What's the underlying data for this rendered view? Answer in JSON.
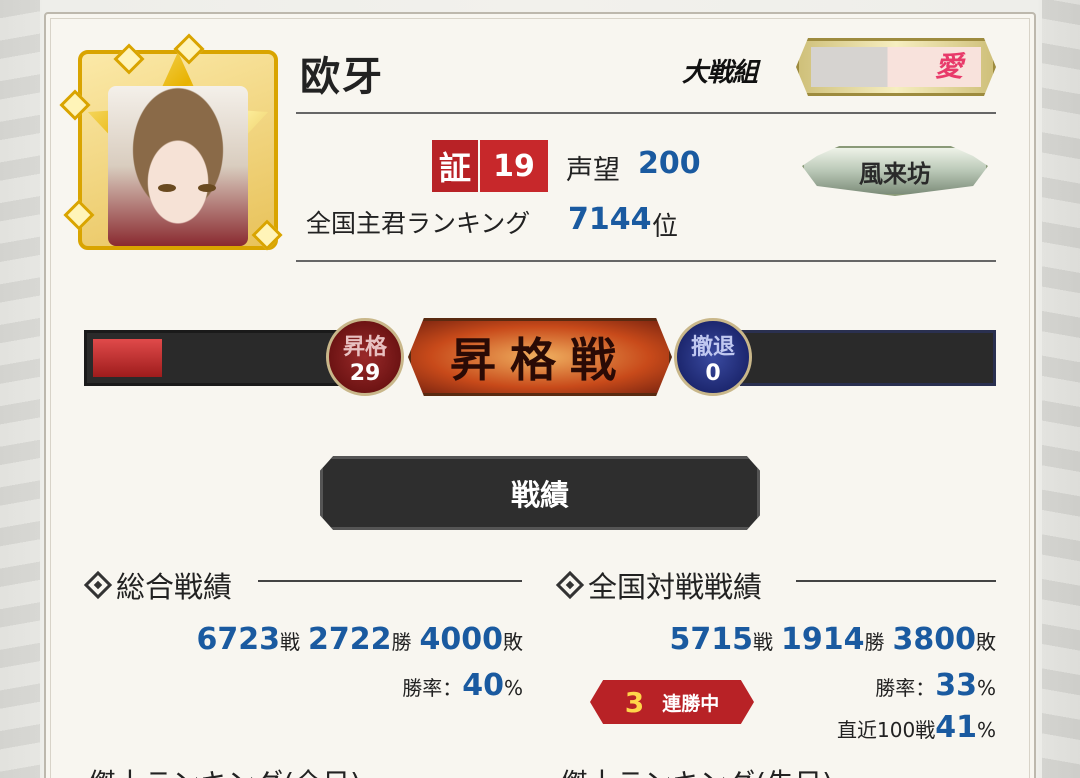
{
  "player": {
    "name": "欧牙"
  },
  "corps": {
    "label": "大戦組",
    "badge_char": "愛"
  },
  "certificate": {
    "label": "証",
    "value": "19"
  },
  "fame": {
    "label": "声望",
    "value": "200"
  },
  "ranking": {
    "label": "全国主君ランキング",
    "value": "7144",
    "unit": "位"
  },
  "title_badge": {
    "text": "風来坊"
  },
  "promotion": {
    "center_label": "昇格戦",
    "promo_label": "昇格",
    "promo_value": "29",
    "retreat_label": "撤退",
    "retreat_value": "0",
    "progress_fraction": 0.28
  },
  "record_header": "戦績",
  "overall": {
    "title": "総合戦績",
    "battles": "6723",
    "battles_unit": "戦",
    "wins": "2722",
    "wins_unit": "勝",
    "losses": "4000",
    "losses_unit": "敗",
    "winrate_label": "勝率：",
    "winrate": "40",
    "pct": "%"
  },
  "national": {
    "title": "全国対戦戦績",
    "battles": "5715",
    "battles_unit": "戦",
    "wins": "1914",
    "wins_unit": "勝",
    "losses": "3800",
    "losses_unit": "敗",
    "winrate_label": "勝率：",
    "winrate": "33",
    "pct": "%",
    "recent_label": "直近100戦",
    "recent": "41",
    "recent_pct": "%",
    "streak_value": "3",
    "streak_label": "連勝中"
  },
  "below": {
    "left_title": "傑士ランキング(全日)",
    "right_title": "傑士ランキング(先日)"
  },
  "colors": {
    "accent_blue": "#1a5aa0",
    "accent_red": "#b82226"
  }
}
